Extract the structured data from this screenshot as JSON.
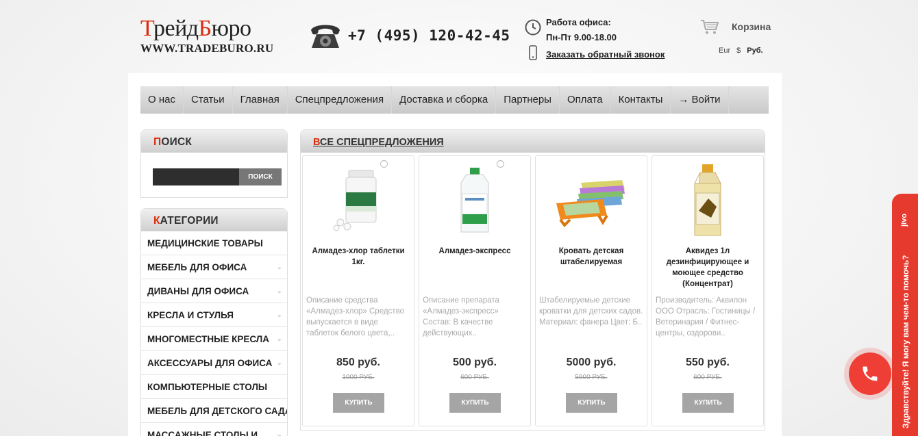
{
  "header": {
    "logo_part1": "Трейд",
    "logo_part2": "Бюро",
    "logo_url": "WWW.TRADEBURO.RU",
    "phone": "+7 (495) 120-42-45",
    "office_title": "Работа офиса:",
    "office_hours": "Пн-Пт 9.00-18.00",
    "callback_label": "Заказать обратный звонок",
    "cart_label": "Корзина",
    "currencies": [
      "Eur",
      "$",
      "Руб."
    ],
    "active_currency": "Руб."
  },
  "nav": [
    "О нас",
    "Статьи",
    "Главная",
    "Спецпредложения",
    "Доставка и сборка",
    "Партнеры",
    "Оплата",
    "Контакты",
    "→ Войти"
  ],
  "search": {
    "title_first": "П",
    "title_rest": "ОИСК",
    "button_label": "ПОИСК"
  },
  "categories": {
    "title_first": "К",
    "title_rest": "АТЕГОРИИ",
    "items": [
      {
        "label": "МЕДИЦИНСКИЕ ТОВАРЫ",
        "arrow": ""
      },
      {
        "label": "МЕБЕЛЬ ДЛЯ ОФИСА",
        "arrow": "⌄"
      },
      {
        "label": "ДИВАНЫ ДЛЯ ОФИСА",
        "arrow": "⌄"
      },
      {
        "label": "КРЕСЛА И СТУЛЬЯ",
        "arrow": "⌄"
      },
      {
        "label": "МНОГОМЕСТНЫЕ КРЕСЛА",
        "arrow": "⌄"
      },
      {
        "label": "АКСЕССУАРЫ ДЛЯ ОФИСА",
        "arrow": "⌄"
      },
      {
        "label": "КОМПЬЮТЕРНЫЕ СТОЛЫ",
        "arrow": ""
      },
      {
        "label": "МЕБЕЛЬ ДЛЯ ДЕТСКОГО САДА",
        "arrow": "⌄"
      },
      {
        "label": "МАССАЖНЫЕ СТОЛЫ И",
        "arrow": "⌄"
      }
    ]
  },
  "offers": {
    "title_first": "В",
    "title_rest": "СЕ СПЕЦПРЕДЛОЖЕНИЯ",
    "buy_label": "КУПИТЬ",
    "products": [
      {
        "name": "Алмадез-хлор таблетки 1кг.",
        "description": "Описание средства «Алмадез-хлор» Средство выпускается в виде таблеток белого цвета,..",
        "price": "850 руб.",
        "old_price": "1000 РУБ.",
        "image_icon": "chlorine-tablets-jar-icon"
      },
      {
        "name": "Алмадез-экспресс",
        "description": "Описание препарата «Алмадез-экспресс» Состав: В качестве действующих..",
        "price": "500 руб.",
        "old_price": "600 РУБ.",
        "image_icon": "disinfectant-bottle-icon"
      },
      {
        "name": "Кровать детская штабелируемая",
        "description": "Штабелируемые детские кроватки для детских садов. Материал: фанера Цвет: Б..",
        "price": "5000 руб.",
        "old_price": "5900 РУБ.",
        "image_icon": "stackable-beds-icon"
      },
      {
        "name": "Аквидез 1л дезинфицирующее и моющее средство (Концентрат)",
        "description": "Производитель: Аквилон ООО Отрасль: Гостиницы / Ветеринария / Фитнес-центры, оздорови..",
        "price": "550 руб.",
        "old_price": "600 РУБ.",
        "image_icon": "concentrate-bottle-icon"
      }
    ]
  },
  "widget": {
    "chat_text": "Здравствуйте! Я могу вам чем-то помочь?",
    "brand": "jivo"
  },
  "colors": {
    "accent": "#d72d0f",
    "call_button": "#ef3e36",
    "chat_tab": "#e73a2f"
  }
}
